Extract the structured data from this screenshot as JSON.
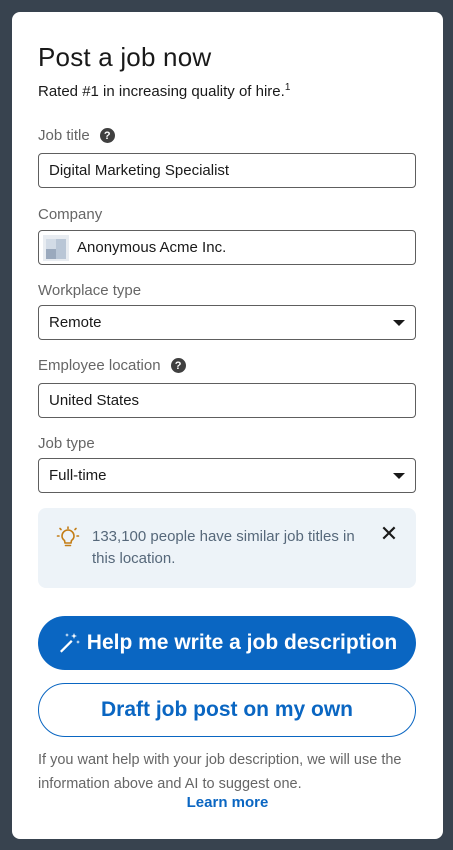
{
  "form": {
    "title": "Post a job now",
    "subtitle": "Rated #1 in increasing quality of hire.",
    "subtitle_footnote": "1",
    "job_title": {
      "label": "Job title",
      "value": "Digital Marketing Specialist"
    },
    "company": {
      "label": "Company",
      "value": "Anonymous Acme Inc."
    },
    "workplace_type": {
      "label": "Workplace type",
      "value": "Remote"
    },
    "employee_location": {
      "label": "Employee location",
      "value": "United States"
    },
    "job_type": {
      "label": "Job type",
      "value": "Full-time"
    }
  },
  "info": {
    "text": "133,100 people have similar job titles in this location.",
    "close_glyph": "✕"
  },
  "actions": {
    "primary_label": "Help me write a job description",
    "secondary_label": "Draft job post on my own"
  },
  "footer": {
    "text": "If you want help with your job description, we will use the information above and AI to suggest one.",
    "learn_more": "Learn more"
  },
  "icons": {
    "help_glyph": "?"
  },
  "colors": {
    "background": "#38434f",
    "primary": "#0a66c2",
    "info_bg": "#edf3f8",
    "bulb": "#c37d16"
  }
}
